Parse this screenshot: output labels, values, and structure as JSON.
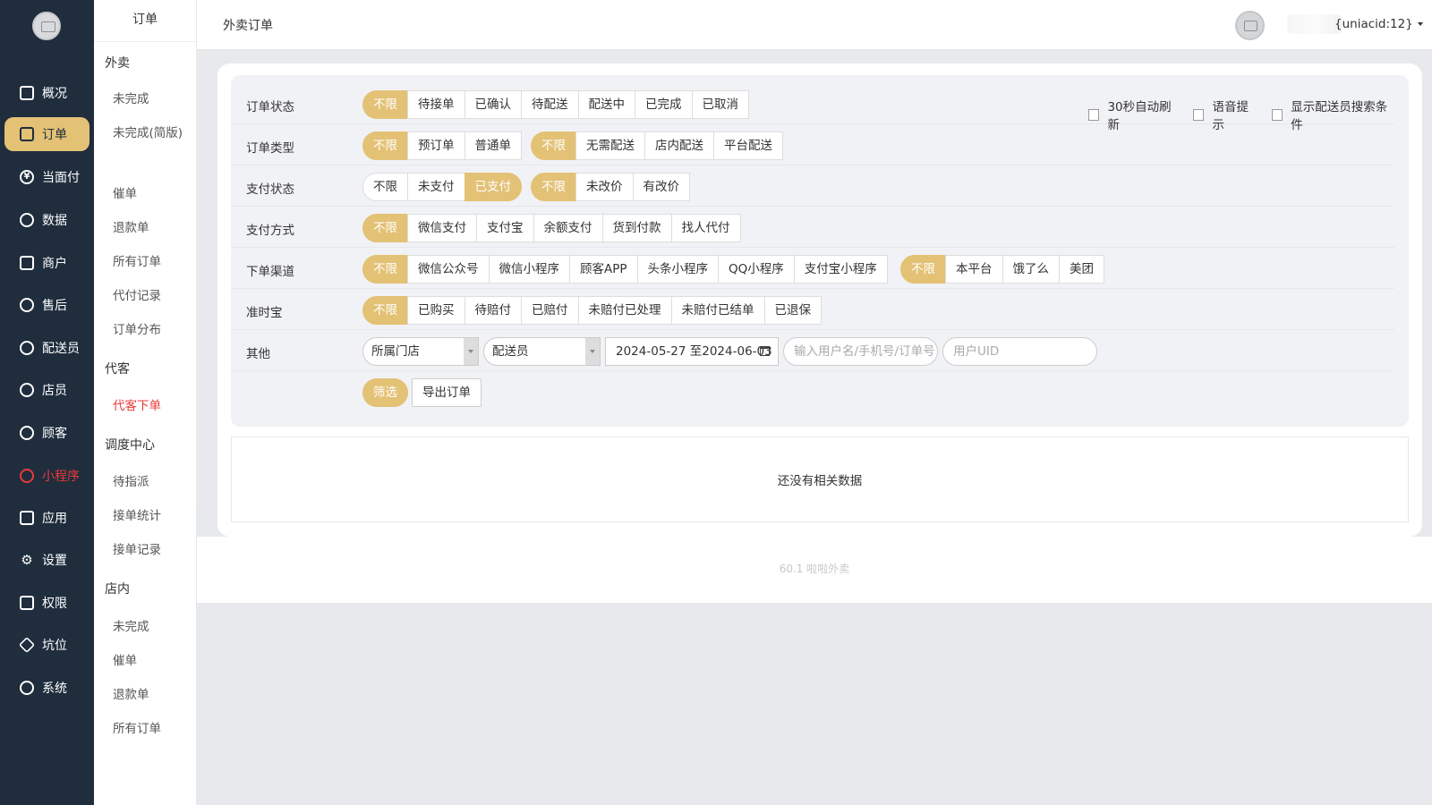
{
  "nav": {
    "items": [
      {
        "label": "概况",
        "icon": "overview-icon"
      },
      {
        "label": "订单",
        "icon": "order-icon",
        "active": true
      },
      {
        "label": "当面付",
        "icon": "yen-icon"
      },
      {
        "label": "数据",
        "icon": "chart-icon"
      },
      {
        "label": "商户",
        "icon": "store-icon"
      },
      {
        "label": "售后",
        "icon": "service-icon"
      },
      {
        "label": "配送员",
        "icon": "courier-icon"
      },
      {
        "label": "店员",
        "icon": "clerk-icon"
      },
      {
        "label": "顾客",
        "icon": "customer-icon"
      },
      {
        "label": "小程序",
        "icon": "miniprogram-icon",
        "red": true
      },
      {
        "label": "应用",
        "icon": "apps-icon"
      },
      {
        "label": "设置",
        "icon": "gear-icon"
      },
      {
        "label": "权限",
        "icon": "lock-icon"
      },
      {
        "label": "坑位",
        "icon": "cube-icon"
      },
      {
        "label": "系统",
        "icon": "system-icon"
      }
    ]
  },
  "subnav": {
    "title": "订单",
    "groups": [
      {
        "label": "外卖",
        "items": [
          "未完成",
          "未完成(简版)",
          "催单",
          "退款单",
          "所有订单",
          "代付记录",
          "订单分布"
        ]
      },
      {
        "label": "代客",
        "items": [
          "代客下单"
        ]
      },
      {
        "label": "调度中心",
        "items": [
          "待指派",
          "接单统计",
          "接单记录"
        ]
      },
      {
        "label": "店内",
        "items": [
          "未完成",
          "催单",
          "退款单",
          "所有订单"
        ]
      }
    ]
  },
  "header": {
    "title": "外卖订单",
    "user": "{uniacid:12}"
  },
  "filters": {
    "order_status": {
      "label": "订单状态",
      "options": [
        "不限",
        "待接单",
        "已确认",
        "待配送",
        "配送中",
        "已完成",
        "已取消"
      ]
    },
    "order_type": {
      "label": "订单类型",
      "options_a": [
        "不限",
        "预订单",
        "普通单"
      ],
      "options_b": [
        "不限",
        "无需配送",
        "店内配送",
        "平台配送"
      ]
    },
    "pay_status": {
      "label": "支付状态",
      "options_a": [
        "不限",
        "未支付",
        "已支付"
      ],
      "options_b": [
        "不限",
        "未改价",
        "有改价"
      ]
    },
    "pay_method": {
      "label": "支付方式",
      "options": [
        "不限",
        "微信支付",
        "支付宝",
        "余额支付",
        "货到付款",
        "找人代付"
      ]
    },
    "channel": {
      "label": "下单渠道",
      "options_a": [
        "不限",
        "微信公众号",
        "微信小程序",
        "顾客APP",
        "头条小程序",
        "QQ小程序",
        "支付宝小程序"
      ],
      "options_b": [
        "不限",
        "本平台",
        "饿了么",
        "美团"
      ]
    },
    "ontime": {
      "label": "准时宝",
      "options": [
        "不限",
        "已购买",
        "待赔付",
        "已赔付",
        "未赔付已处理",
        "未赔付已结单",
        "已退保"
      ]
    },
    "other": {
      "label": "其他",
      "store_select": "所属门店",
      "courier_select": "配送员",
      "date_range": "2024-05-27 至2024-06-03",
      "keyword_placeholder": "输入用户名/手机号/订单号",
      "uid_placeholder": "用户UID"
    },
    "checkboxes": [
      "30秒自动刷新",
      "语音提示",
      "显示配送员搜索条件"
    ],
    "filter_button": "筛选",
    "export_button": "导出订单"
  },
  "empty_text": "还没有相关数据",
  "footer": "60.1 啦啦外卖",
  "colors": {
    "accent": "#e3c175",
    "nav_bg": "#1f2d3d",
    "danger": "#e83a3a"
  }
}
